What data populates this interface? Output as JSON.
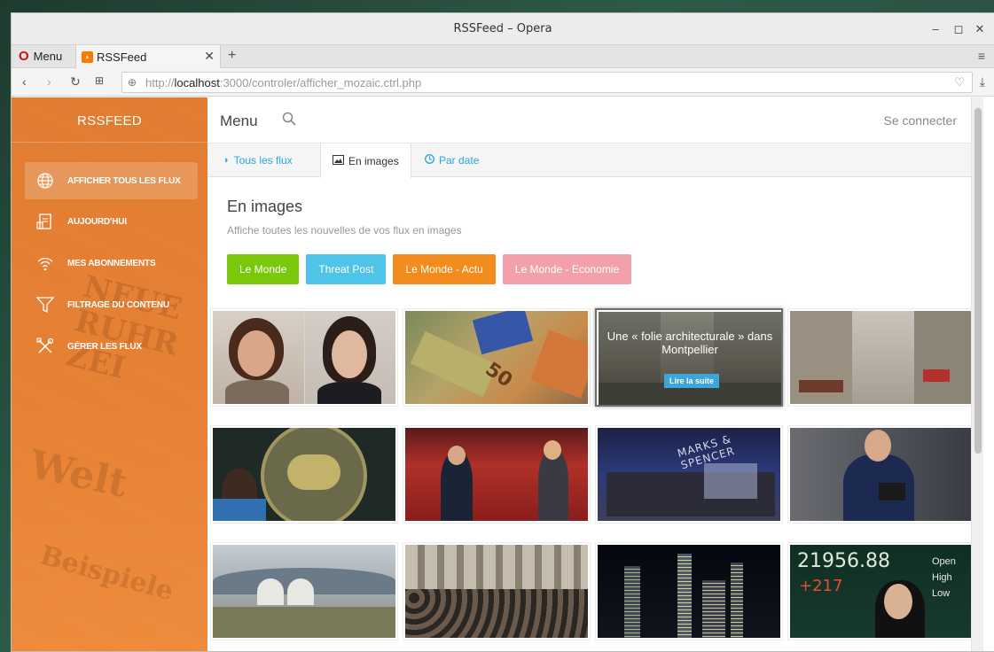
{
  "window": {
    "title": "RSSFeed – Opera"
  },
  "tabbar": {
    "menu_label": "Menu",
    "tab_title": "RSSFeed"
  },
  "address": {
    "url_prefix": "http://",
    "url_host": "localhost",
    "url_rest": ":3000/controler/afficher_mozaic.ctrl.php"
  },
  "sidebar": {
    "brand": "RSSFEED",
    "items": [
      {
        "label": "AFFICHER TOUS LES FLUX",
        "icon": "globe-icon",
        "active": true
      },
      {
        "label": "AUJOURD'HUI",
        "icon": "calendar-icon",
        "active": false
      },
      {
        "label": "MES ABONNEMENTS",
        "icon": "wifi-icon",
        "active": false
      },
      {
        "label": "FILTRAGE DU CONTENU",
        "icon": "filter-icon",
        "active": false
      },
      {
        "label": "GÉRER LES FLUX",
        "icon": "tools-icon",
        "active": false
      }
    ]
  },
  "topnav": {
    "menu": "Menu",
    "login": "Se connecter"
  },
  "tabs": [
    {
      "label": "Tous les flux",
      "icon": "rss-icon"
    },
    {
      "label": "En images",
      "icon": "image-icon"
    },
    {
      "label": "Par date",
      "icon": "clock-icon"
    }
  ],
  "section": {
    "title": "En images",
    "subtitle": "Affiche toutes les nouvelles de vos flux en images"
  },
  "filters": [
    {
      "label": "Le Monde",
      "color": "#7ac70c"
    },
    {
      "label": "Threat Post",
      "color": "#4ec4e8"
    },
    {
      "label": "Le Monde - Actu",
      "color": "#f28c1e"
    },
    {
      "label": "Le Monde - Economie",
      "color": "#f2a1ab"
    }
  ],
  "tiles": [
    {
      "image": "two-women-portraits"
    },
    {
      "image": "euro-banknotes"
    },
    {
      "image": "tower-montpellier",
      "overlay_title": "Une « folie architecturale » dans Montpellier",
      "overlay_button": "Lire la suite"
    },
    {
      "image": "paris-street"
    },
    {
      "image": "reserve-bank-india"
    },
    {
      "image": "national-assembly"
    },
    {
      "image": "marks-spencer-store"
    },
    {
      "image": "man-in-suit"
    },
    {
      "image": "nuclear-plant"
    },
    {
      "image": "crowd-street"
    },
    {
      "image": "city-night"
    },
    {
      "image": "stock-board"
    }
  ],
  "stock_board": {
    "number": "21956.88",
    "change": "+217",
    "labels": [
      "Open",
      "High",
      "Low"
    ]
  }
}
